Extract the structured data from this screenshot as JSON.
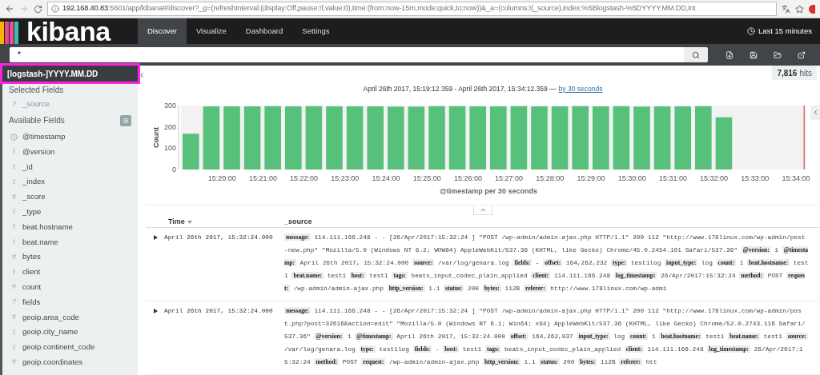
{
  "browser": {
    "url_host": "192.168.40.83",
    "url_path": ":5601/app/kibana#/discover?_g=(refreshInterval:(display:Off,pause:!f,value:0),time:(from:now-15m,mode:quick,to:now))&_a=(columns:!(_source),index:%5Blogstash-%5DYYYY.MM.DD,int"
  },
  "nav": {
    "logo": "kibana",
    "tabs": [
      {
        "label": "Discover",
        "selected": true
      },
      {
        "label": "Visualize",
        "selected": false
      },
      {
        "label": "Dashboard",
        "selected": false
      },
      {
        "label": "Settings",
        "selected": false
      }
    ],
    "time_range": "Last 15 minutes"
  },
  "search": {
    "value": "*"
  },
  "sidebar": {
    "index_pattern": "[logstash-]YYYY.MM.DD",
    "highlighted": true,
    "selected_title": "Selected Fields",
    "selected_fields": [
      {
        "kind": "char",
        "icon": "?",
        "name": "_source"
      }
    ],
    "available_title": "Available Fields",
    "available_fields": [
      {
        "kind": "date",
        "name": "@timestamp"
      },
      {
        "kind": "char",
        "icon": "t",
        "name": "@version"
      },
      {
        "kind": "char",
        "icon": "t",
        "name": "_id"
      },
      {
        "kind": "char",
        "icon": "t",
        "name": "_index"
      },
      {
        "kind": "char",
        "icon": "#",
        "name": "_score"
      },
      {
        "kind": "char",
        "icon": "t",
        "name": "_type"
      },
      {
        "kind": "char",
        "icon": "t",
        "name": "beat.hostname"
      },
      {
        "kind": "char",
        "icon": "t",
        "name": "beat.name"
      },
      {
        "kind": "char",
        "icon": "#",
        "name": "bytes"
      },
      {
        "kind": "char",
        "icon": "t",
        "name": "client"
      },
      {
        "kind": "char",
        "icon": "#",
        "name": "count"
      },
      {
        "kind": "char",
        "icon": "?",
        "name": "fields"
      },
      {
        "kind": "char",
        "icon": "#",
        "name": "geoip.area_code"
      },
      {
        "kind": "char",
        "icon": "t",
        "name": "geoip.city_name"
      },
      {
        "kind": "char",
        "icon": "t",
        "name": "geoip.continent_code"
      },
      {
        "kind": "char",
        "icon": "#",
        "name": "geoip.coordinates"
      }
    ]
  },
  "hits": {
    "count": "7,816",
    "label": "hits"
  },
  "histogram": {
    "range_text": "April 26th 2017, 15:19:12.359 - April 26th 2017, 15:34:12.359 —",
    "interval_link": "by 30 seconds",
    "chart_data": {
      "type": "bar",
      "xlabel": "@timestamp per 30 seconds",
      "ylabel": "Count",
      "categories": [
        null,
        null,
        "15:20:00",
        null,
        "15:21:00",
        null,
        "15:22:00",
        null,
        "15:23:00",
        null,
        "15:24:00",
        null,
        "15:25:00",
        null,
        "15:26:00",
        null,
        "15:27:00",
        null,
        "15:28:00",
        null,
        "15:29:00",
        null,
        "15:30:00",
        null,
        "15:31:00",
        null,
        "15:32:00",
        null,
        "15:33:00",
        null,
        "15:34:00"
      ],
      "series": [
        {
          "color": "#57c17b",
          "values": [
            168,
            296,
            296,
            296,
            297,
            296,
            297,
            296,
            296,
            296,
            295,
            295,
            297,
            297,
            296,
            296,
            297,
            296,
            296,
            297,
            296,
            297,
            295,
            296,
            296,
            297,
            245,
            null,
            null,
            null,
            null
          ]
        }
      ],
      "ylim": [
        0,
        300
      ],
      "yticks": [
        0,
        100,
        200,
        300
      ]
    }
  },
  "table": {
    "columns": [
      {
        "label": "Time",
        "sorted": true
      },
      {
        "label": "_source",
        "sorted": false
      }
    ],
    "rows": [
      {
        "time": "April 26th 2017, 15:32:24.000",
        "expanded": false,
        "fields": [
          {
            "key": "message:",
            "value": "114.111.166.248 - - [26/Apr/2017:15:32:24 ] \"POST /wp-admin/admin-ajax.php HTTP/1.1\" 200 112 \"http://www.178linux.com/wp-admin/post-new.php\" \"Mozilla/5.0 (Windows NT 6.2; WOW64) AppleWebKit/537.36 (KHTML, like Gecko) Chrome/45.0.2454.101 Safari/537.36\""
          },
          {
            "key": "@version:",
            "value": "1"
          },
          {
            "key": "@timestamp:",
            "value": "April 26th 2017, 15:32:24.000"
          },
          {
            "key": "source:",
            "value": "/var/log/genara.log"
          },
          {
            "key": "fields:",
            "value": "-"
          },
          {
            "key": "offset:",
            "value": "164,262,232"
          },
          {
            "key": "type:",
            "value": "test1log"
          },
          {
            "key": "input_type:",
            "value": "log"
          },
          {
            "key": "count:",
            "value": "1"
          },
          {
            "key": "beat.hostname:",
            "value": "test1"
          },
          {
            "key": "beat.name:",
            "value": "test1"
          },
          {
            "key": "host:",
            "value": "test1"
          },
          {
            "key": "tags:",
            "value": "beats_input_codec_plain_applied"
          },
          {
            "key": "client:",
            "value": "114.111.166.248"
          },
          {
            "key": "log_timestamp:",
            "value": "26/Apr/2017:15:32:24"
          },
          {
            "key": "method:",
            "value": "POST"
          },
          {
            "key": "request:",
            "value": "/wp-admin/admin-ajax.php"
          },
          {
            "key": "http_version:",
            "value": "1.1"
          },
          {
            "key": "status:",
            "value": "200"
          },
          {
            "key": "bytes:",
            "value": "112B"
          },
          {
            "key": "referer:",
            "value": "http://www.178linux.com/wp-admi"
          }
        ]
      },
      {
        "time": "April 26th 2017, 15:32:24.000",
        "expanded": false,
        "fields": [
          {
            "key": "message:",
            "value": "114.111.166.248 - - [26/Apr/2017:15:32:24 ] \"POST /wp-admin/admin-ajax.php HTTP/1.1\" 200 112 \"http://www.178linux.com/wp-admin/post.php?post=32616&action=edit\" \"Mozilla/5.0 (Windows NT 6.1; Win64; x64) AppleWebKit/537.36 (KHTML, like Gecko) Chrome/52.0.2743.116 Safari/537.36\""
          },
          {
            "key": "@version:",
            "value": "1"
          },
          {
            "key": "@timestamp:",
            "value": "April 26th 2017, 15:32:24.000"
          },
          {
            "key": "offset:",
            "value": "164,262,937"
          },
          {
            "key": "input_type:",
            "value": "log"
          },
          {
            "key": "count:",
            "value": "1"
          },
          {
            "key": "beat.hostname:",
            "value": "test1"
          },
          {
            "key": "beat.name:",
            "value": "test1"
          },
          {
            "key": "source:",
            "value": "/var/log/genara.log"
          },
          {
            "key": "type:",
            "value": "test1log"
          },
          {
            "key": "fields:",
            "value": "-"
          },
          {
            "key": "host:",
            "value": "test1"
          },
          {
            "key": "tags:",
            "value": "beats_input_codec_plain_applied"
          },
          {
            "key": "client:",
            "value": "114.111.166.248"
          },
          {
            "key": "log_timestamp:",
            "value": "26/Apr/2017:15:32:24"
          },
          {
            "key": "method:",
            "value": "POST"
          },
          {
            "key": "request:",
            "value": "/wp-admin/admin-ajax.php"
          },
          {
            "key": "http_version:",
            "value": "1.1"
          },
          {
            "key": "status:",
            "value": "200"
          },
          {
            "key": "bytes:",
            "value": "112B"
          },
          {
            "key": "referer:",
            "value": "htt"
          }
        ]
      }
    ]
  }
}
